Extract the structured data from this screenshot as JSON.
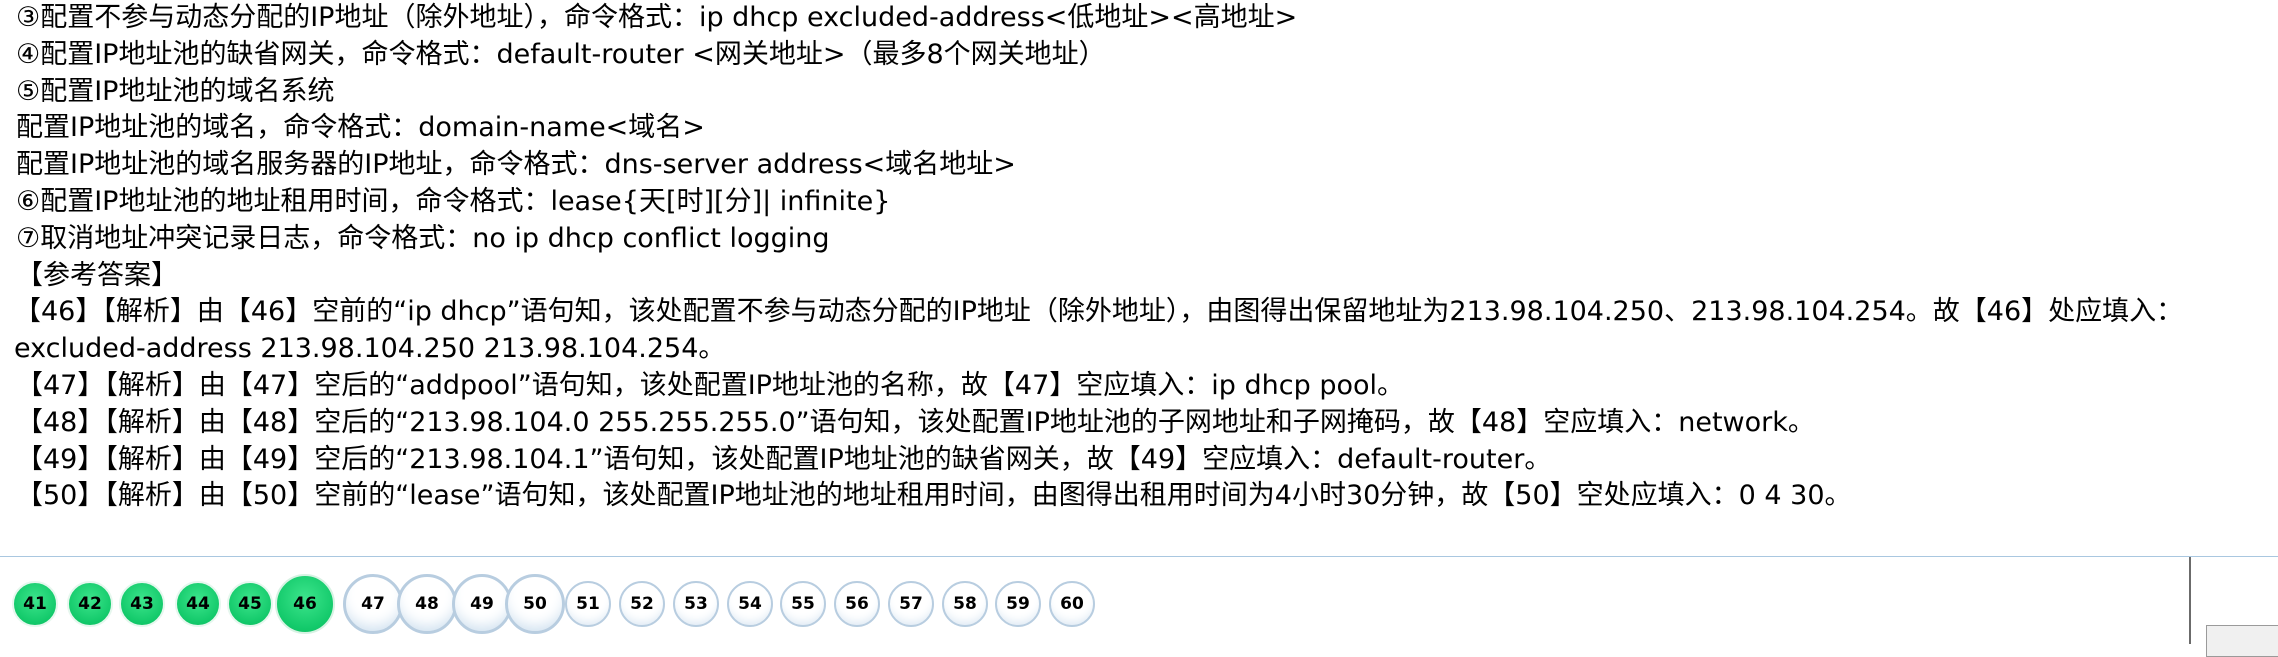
{
  "lines": [
    "③配置不参与动态分配的IP地址（除外地址），命令格式：ip dhcp excluded-address<低地址><高地址>",
    "④配置IP地址池的缺省网关，命令格式：default-router <网关地址>（最多8个网关地址）",
    "⑤配置IP地址池的域名系统",
    "配置IP地址池的域名，命令格式：domain-name<域名>",
    "配置IP地址池的域名服务器的IP地址，命令格式：dns-server address<域名地址>",
    "⑥配置IP地址池的地址租用时间，命令格式：lease{天[时][分]| infinite}",
    "⑦取消地址冲突记录日志，命令格式：no ip dhcp conflict logging",
    "【参考答案】",
    "【46】【解析】由【46】空前的“ip dhcp”语句知，该处配置不参与动态分配的IP地址（除外地址），由图得出保留地址为213.98.104.250、213.98.104.254。故【46】处应填入：excluded-address 213.98.104.250 213.98.104.254。",
    "【47】【解析】由【47】空后的“addpool”语句知，该处配置IP地址池的名称，故【47】空应填入：ip dhcp pool。",
    "【48】【解析】由【48】空后的“213.98.104.0 255.255.255.0”语句知，该处配置IP地址池的子网地址和子网掩码，故【48】空应填入：network。",
    "【49】【解析】由【49】空后的“213.98.104.1”语句知，该处配置IP地址池的缺省网关，故【49】空应填入：default-router。",
    "【50】【解析】由【50】空前的“lease”语句知，该处配置IP地址池的地址租用时间，由图得出租用时间为4小时30分钟，故【50】空处应填入：0 4 30。"
  ],
  "question_nav": {
    "items": [
      {
        "label": "41",
        "state": "answered"
      },
      {
        "label": "42",
        "state": "answered"
      },
      {
        "label": "43",
        "state": "answered"
      },
      {
        "label": "44",
        "state": "answered"
      },
      {
        "label": "45",
        "state": "answered"
      },
      {
        "label": "46",
        "state": "current"
      },
      {
        "label": "47",
        "state": "unanswered-big"
      },
      {
        "label": "48",
        "state": "unanswered-big"
      },
      {
        "label": "49",
        "state": "unanswered-big"
      },
      {
        "label": "50",
        "state": "unanswered-big"
      },
      {
        "label": "51",
        "state": "unanswered"
      },
      {
        "label": "52",
        "state": "unanswered"
      },
      {
        "label": "53",
        "state": "unanswered"
      },
      {
        "label": "54",
        "state": "unanswered"
      },
      {
        "label": "55",
        "state": "unanswered"
      },
      {
        "label": "56",
        "state": "unanswered"
      },
      {
        "label": "57",
        "state": "unanswered"
      },
      {
        "label": "58",
        "state": "unanswered"
      },
      {
        "label": "59",
        "state": "unanswered"
      },
      {
        "label": "60",
        "state": "unanswered"
      }
    ]
  },
  "colors": {
    "answered": "#12c96a",
    "unanswered_border": "#b8cde0",
    "divider": "#a9c7e0"
  }
}
